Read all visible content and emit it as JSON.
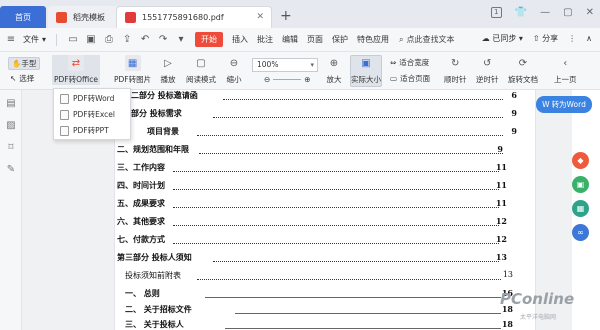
{
  "tabs": {
    "home": "首页",
    "straw": "稻壳模板",
    "pdf": "1551775891680.pdf",
    "plus": "+"
  },
  "menubar": {
    "file": "文件",
    "start": "开始",
    "items": [
      "插入",
      "批注",
      "编辑",
      "页面",
      "保护",
      "特色应用"
    ],
    "search": "点此查找文本",
    "sync": "已同步",
    "share": "分享"
  },
  "ribbon": {
    "hand": "手型",
    "select": "选择",
    "pdf_to_office": "PDF转Office",
    "pdf_to_image": "PDF转图片",
    "play": "播放",
    "read_mode": "阅读模式",
    "zoom_out": "缩小",
    "zoom_value": "100%",
    "zoom_in": "放大",
    "actual_size": "实际大小",
    "fit_width": "适合宽度",
    "fit_page": "适合页面",
    "rotate_cw": "顺时针",
    "rotate_ccw": "逆时针",
    "rotate_doc": "旋转文档",
    "prev_page": "上一页"
  },
  "dropdown": {
    "items": [
      "PDF转Word",
      "PDF转Excel",
      "PDF转PPT"
    ]
  },
  "float": {
    "to_word": "转为Word"
  },
  "toc": [
    {
      "text": "二部分   投标邀请函",
      "page": "6"
    },
    {
      "text": "部分   投标需求",
      "page": "9"
    },
    {
      "text": "项目背景",
      "page": "9"
    },
    {
      "text": "二、规划范围和年限",
      "page": "9"
    },
    {
      "text": "三、工作内容",
      "page": "11"
    },
    {
      "text": "四、时间计划",
      "page": "11"
    },
    {
      "text": "五、成果要求",
      "page": "11"
    },
    {
      "text": "六、其他要求",
      "page": "12"
    },
    {
      "text": "七、付款方式",
      "page": "12"
    },
    {
      "text": "第三部分   投标人须知",
      "page": "13"
    },
    {
      "text": "投标须知前附表",
      "page": "13"
    },
    {
      "text": "一、        总则",
      "page": "16"
    },
    {
      "text": "二、        关于招标文件",
      "page": "18"
    },
    {
      "text": "三、        关于投标人",
      "page": "18"
    }
  ],
  "watermark": {
    "main": "PConline",
    "sub": "太平洋电脑网"
  },
  "colors": {
    "accent_blue": "#3b6fd6",
    "start_red": "#ee4b3a",
    "word_blue": "#3b83e0",
    "float_orange": "#f05a3c",
    "float_green": "#3ab16a",
    "float_teal": "#2ea38a",
    "float_blue": "#3b78d8"
  }
}
